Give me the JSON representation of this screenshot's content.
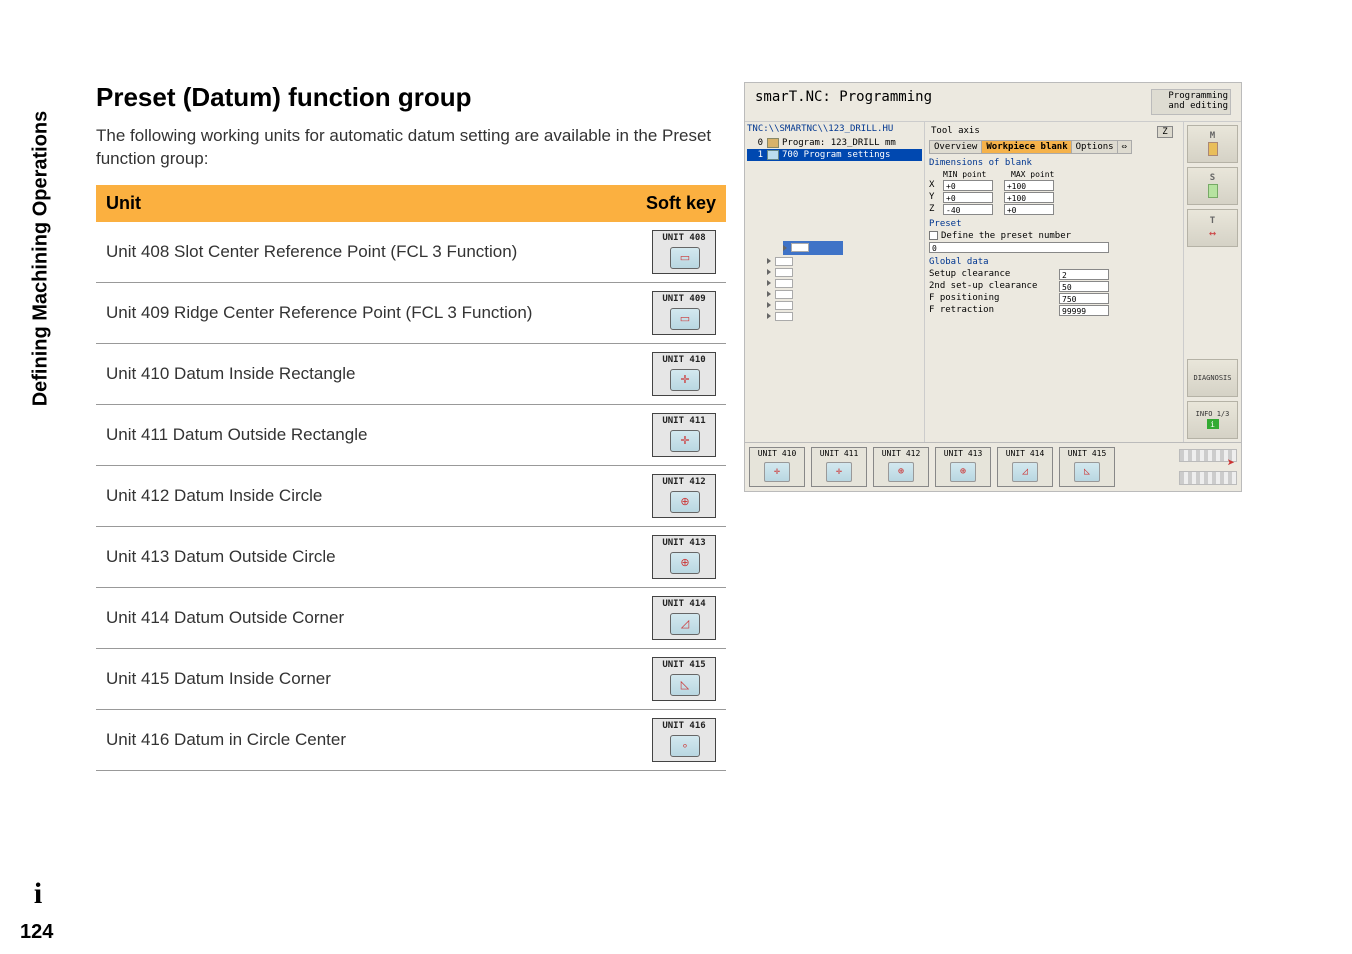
{
  "side_tab": "Defining Machining Operations",
  "heading": "Preset (Datum) function group",
  "intro": "The following working units for automatic datum setting are available in the Preset function group:",
  "table": {
    "header_unit": "Unit",
    "header_softkey": "Soft key",
    "rows": [
      {
        "text": "Unit 408 Slot Center Reference Point (FCL 3 Function)",
        "sk_label": "UNIT 408",
        "glyph": "▭"
      },
      {
        "text": "Unit 409 Ridge Center Reference Point (FCL 3 Function)",
        "sk_label": "UNIT 409",
        "glyph": "▭"
      },
      {
        "text": "Unit 410 Datum Inside Rectangle",
        "sk_label": "UNIT 410",
        "glyph": "✛"
      },
      {
        "text": "Unit 411 Datum Outside Rectangle",
        "sk_label": "UNIT 411",
        "glyph": "✛"
      },
      {
        "text": "Unit 412 Datum Inside Circle",
        "sk_label": "UNIT 412",
        "glyph": "⊕"
      },
      {
        "text": "Unit 413 Datum Outside Circle",
        "sk_label": "UNIT 413",
        "glyph": "⊕"
      },
      {
        "text": "Unit 414 Datum Outside Corner",
        "sk_label": "UNIT 414",
        "glyph": "◿"
      },
      {
        "text": "Unit 415 Datum Inside Corner",
        "sk_label": "UNIT 415",
        "glyph": "◺"
      },
      {
        "text": "Unit 416 Datum in Circle Center",
        "sk_label": "UNIT 416",
        "glyph": "∘"
      }
    ]
  },
  "screenshot": {
    "title": "smarT.NC: Programming",
    "mode_line1": "Programming",
    "mode_line2": "and editing",
    "path": "TNC:\\\\SMARTNC\\\\123_DRILL.HU",
    "tree": {
      "row0_num": "0",
      "row0_text": "Program: 123_DRILL mm",
      "row1_num": "1",
      "row1_text": "700 Program settings"
    },
    "form": {
      "tool_axis_label": "Tool axis",
      "tool_axis_value": "Z",
      "tab_overview": "Overview",
      "tab_blank": "Workpiece blank",
      "tab_options": "Options",
      "dims_title": "Dimensions of blank",
      "col_min": "MIN point",
      "col_max": "MAX point",
      "x_label": "X",
      "x_min": "+0",
      "x_max": "+100",
      "y_label": "Y",
      "y_min": "+0",
      "y_max": "+100",
      "z_label": "Z",
      "z_min": "-40",
      "z_max": "+0",
      "preset_title": "Preset",
      "preset_check_label": "Define the preset number",
      "preset_value": "0",
      "global_title": "Global data",
      "setup_clearance_label": "Setup clearance",
      "setup_clearance_val": "2",
      "second_setup_label": "2nd set-up clearance",
      "second_setup_val": "50",
      "f_pos_label": "F positioning",
      "f_pos_val": "750",
      "f_ret_label": "F retraction",
      "f_ret_val": "99999"
    },
    "rightbar": {
      "m_label": "M",
      "s_label": "S",
      "t_label": "T",
      "diag": "DIAGNOSIS",
      "info": "INFO 1/3"
    },
    "softkeys": [
      {
        "label": "UNIT 410",
        "glyph": "✛"
      },
      {
        "label": "UNIT 411",
        "glyph": "✛"
      },
      {
        "label": "UNIT 412",
        "glyph": "⊕"
      },
      {
        "label": "UNIT 413",
        "glyph": "⊕"
      },
      {
        "label": "UNIT 414",
        "glyph": "◿"
      },
      {
        "label": "UNIT 415",
        "glyph": "◺"
      }
    ]
  },
  "info_icon": "i",
  "page_number": "124"
}
